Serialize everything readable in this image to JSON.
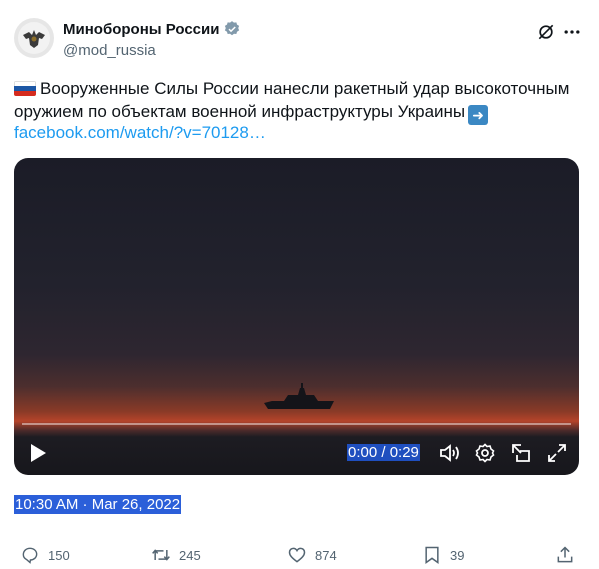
{
  "author": {
    "display_name": "Минобороны России",
    "handle": "@mod_russia",
    "verified_icon": "verified-badge-icon",
    "avatar_icon": "eagle-emblem-icon"
  },
  "tweet": {
    "flag_icon": "russia-flag-emoji",
    "text": "Вооруженные Силы России нанесли ракетный удар высокоточным оружием по объектам военной инфраструктуры Украины",
    "arrow_icon": "right-arrow-emoji",
    "link": "facebook.com/watch/?v=70128…"
  },
  "video": {
    "time": "0:00 / 0:29",
    "progress": 0
  },
  "timestamp": "10:30 AM · Mar 26, 2022",
  "actions": {
    "replies": "150",
    "retweets": "245",
    "likes": "874",
    "bookmarks": "39"
  },
  "colors": {
    "link": "#1d9bf0",
    "secondary_text": "#536471",
    "selection": "#2b5fd9"
  }
}
